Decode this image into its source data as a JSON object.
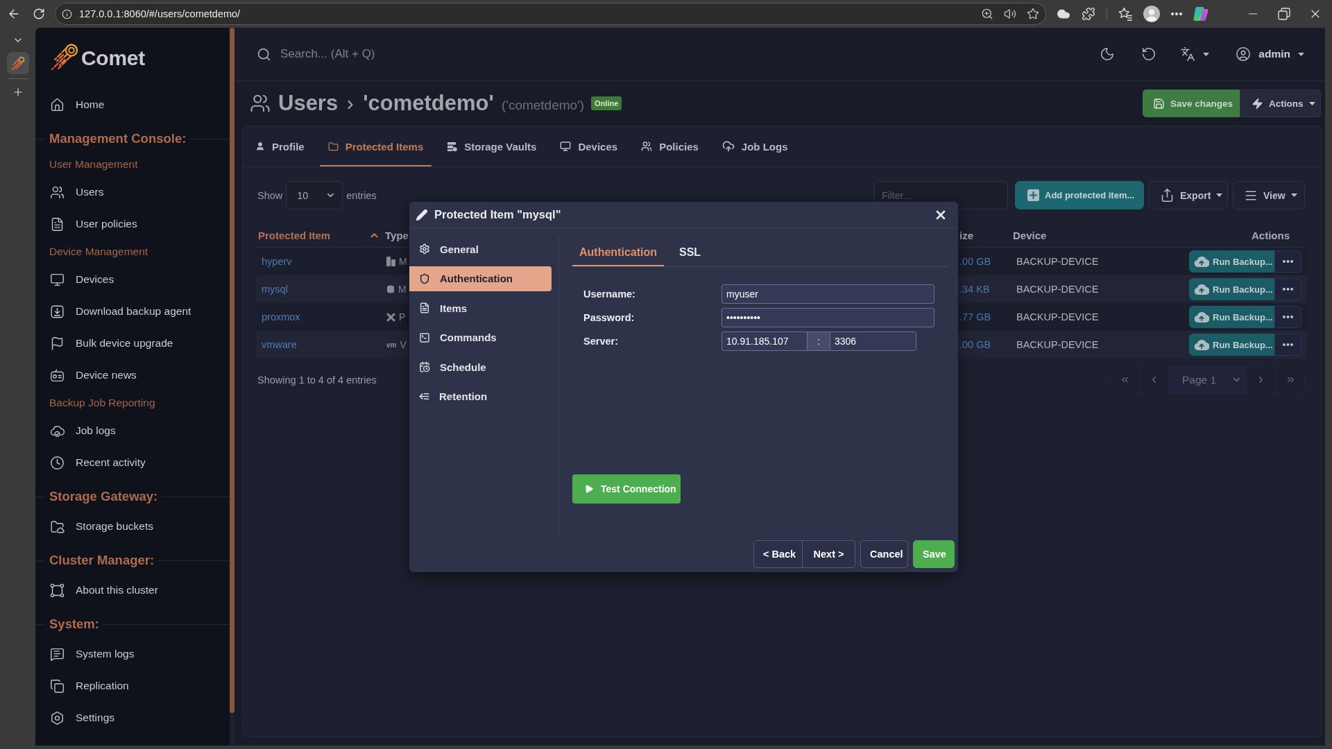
{
  "browser": {
    "url": "127.0.0.1:8060/#/users/cometdemo/"
  },
  "sidebar": {
    "brand": "Comet",
    "items": [
      {
        "kind": "link",
        "label": "Home"
      },
      {
        "kind": "heading",
        "label": "Management Console:"
      },
      {
        "kind": "subheading",
        "label": "User Management"
      },
      {
        "kind": "link",
        "label": "Users"
      },
      {
        "kind": "link",
        "label": "User policies"
      },
      {
        "kind": "subheading",
        "label": "Device Management"
      },
      {
        "kind": "link",
        "label": "Devices"
      },
      {
        "kind": "link",
        "label": "Download backup agent"
      },
      {
        "kind": "link",
        "label": "Bulk device upgrade"
      },
      {
        "kind": "link",
        "label": "Device news"
      },
      {
        "kind": "subheading",
        "label": "Backup Job Reporting"
      },
      {
        "kind": "link",
        "label": "Job logs"
      },
      {
        "kind": "link",
        "label": "Recent activity"
      },
      {
        "kind": "heading",
        "label": "Storage Gateway:"
      },
      {
        "kind": "link",
        "label": "Storage buckets"
      },
      {
        "kind": "heading",
        "label": "Cluster Manager:"
      },
      {
        "kind": "link",
        "label": "About this cluster"
      },
      {
        "kind": "heading",
        "label": "System:"
      },
      {
        "kind": "link",
        "label": "System logs"
      },
      {
        "kind": "link",
        "label": "Replication"
      },
      {
        "kind": "link",
        "label": "Settings"
      }
    ]
  },
  "header": {
    "search_placeholder": "Search... (Alt + Q)",
    "user": "admin"
  },
  "page": {
    "breadcrumb": [
      "Users",
      "'cometdemo'"
    ],
    "subtitle": "('cometdemo')",
    "status": "Online",
    "actions": [
      {
        "kind": "save",
        "label": "Save changes"
      },
      {
        "kind": "menu",
        "label": "Actions"
      }
    ]
  },
  "tabs": [
    {
      "label": "Profile",
      "selected": false
    },
    {
      "label": "Protected Items",
      "selected": true
    },
    {
      "label": "Storage Vaults",
      "selected": false
    },
    {
      "label": "Devices",
      "selected": false
    },
    {
      "label": "Policies",
      "selected": false
    },
    {
      "label": "Job Logs",
      "selected": false
    }
  ],
  "table_controls": {
    "show": "Show",
    "page_size": "10",
    "entries": "entries",
    "filter_placeholder": "Filter...",
    "buttons": [
      {
        "kind": "add",
        "label": "Add protected item..."
      },
      {
        "kind": "export",
        "label": "Export"
      },
      {
        "kind": "view",
        "label": "View"
      }
    ]
  },
  "table": {
    "columns": [
      {
        "label": "Protected Item",
        "sorted": true
      },
      {
        "label": "Type",
        "sorted": false
      },
      {
        "label": "ize",
        "sorted": false
      },
      {
        "label": "Device",
        "sorted": false
      },
      {
        "label": "Actions",
        "sorted": false
      }
    ],
    "rows": [
      {
        "name": "hyperv",
        "kind": "hyperv",
        "type": "M",
        "size": ".00 GB",
        "device": "BACKUP-DEVICE",
        "action": "Run Backup..."
      },
      {
        "name": "mysql",
        "kind": "mysql",
        "type": "M",
        "size": ".34 KB",
        "device": "BACKUP-DEVICE",
        "action": "Run Backup..."
      },
      {
        "name": "proxmox",
        "kind": "proxmox",
        "type": "P",
        "size": ".77 GB",
        "device": "BACKUP-DEVICE",
        "action": "Run Backup..."
      },
      {
        "name": "vmware",
        "kind": "vmware",
        "type_logo": "vm",
        "type": "V",
        "size": ".00 GB",
        "device": "BACKUP-DEVICE",
        "action": "Run Backup..."
      }
    ]
  },
  "table_footer": {
    "info": "Showing 1 to 4 of 4 entries",
    "page": "Page 1"
  },
  "dialog": {
    "title": "Protected Item \"mysql\"",
    "nav": [
      {
        "label": "General",
        "selected": false
      },
      {
        "label": "Authentication",
        "selected": true
      },
      {
        "label": "Items",
        "selected": false
      },
      {
        "label": "Commands",
        "selected": false
      },
      {
        "label": "Schedule",
        "selected": false
      },
      {
        "label": "Retention",
        "selected": false
      }
    ],
    "tabs": [
      {
        "label": "Authentication",
        "selected": true
      },
      {
        "label": "SSL",
        "selected": false
      }
    ],
    "fields": [
      {
        "kind": "text",
        "label": "Username:",
        "value": "myuser"
      },
      {
        "kind": "text",
        "label": "Password:",
        "value": "••••••••••"
      },
      {
        "kind": "host_port",
        "label": "Server:",
        "host": "10.91.185.107",
        "separator": ":",
        "port": "3306"
      }
    ],
    "test_button": "Test Connection",
    "footer": [
      {
        "kind": "back",
        "label": "< Back"
      },
      {
        "kind": "next",
        "label": "Next >"
      },
      {
        "kind": "cancel",
        "label": "Cancel"
      },
      {
        "kind": "save",
        "label": "Save"
      }
    ]
  }
}
